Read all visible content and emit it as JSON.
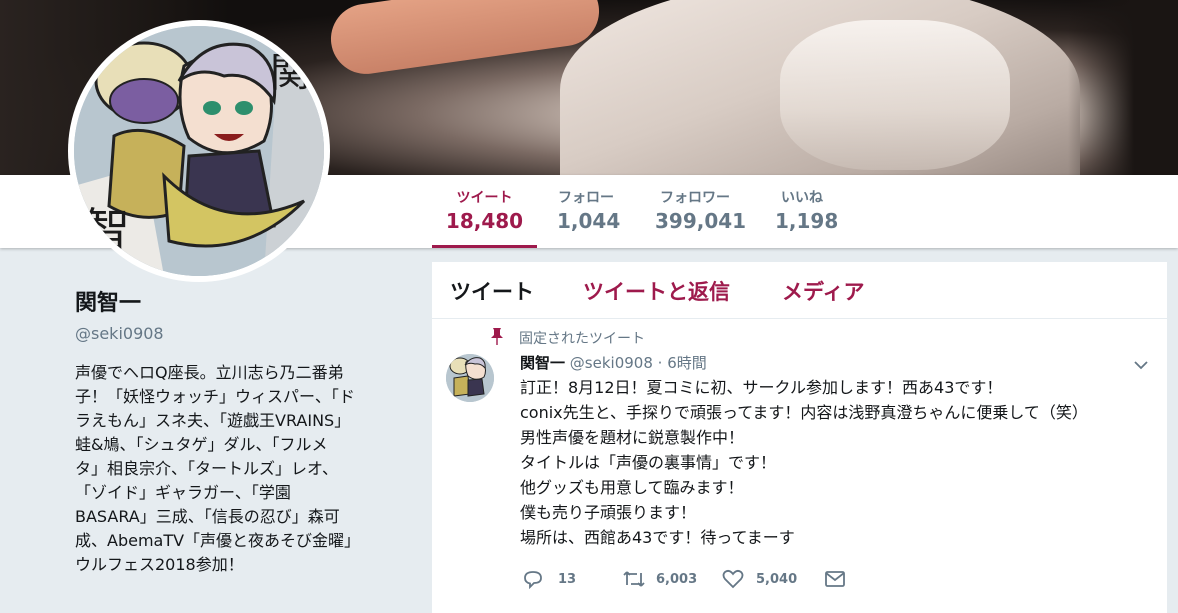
{
  "stats": [
    {
      "label": "ツイート",
      "value": "18,480"
    },
    {
      "label": "フォロー",
      "value": "1,044"
    },
    {
      "label": "フォロワー",
      "value": "399,041"
    },
    {
      "label": "いいね",
      "value": "1,198"
    }
  ],
  "profile": {
    "name": "関智一",
    "handle": "@seki0908",
    "bio_lines": [
      "声優でヘロQ座長。立川志ら乃二番弟",
      "子！「妖怪ウォッチ」ウィスパー、「ド",
      "ラえもん」スネ夫、「遊戯王VRAINS」",
      "蛙&鳩、「シュタゲ」ダル、「フルメ",
      "タ」相良宗介、「タートルズ」レオ、",
      "「ゾイド」ギャラガー、「学園",
      "BASARA」三成、「信長の忍び」森可",
      "成、AbemaTV「声優と夜あそび金曜」",
      "ウルフェス2018参加！"
    ]
  },
  "tabs": [
    "ツイート",
    "ツイートと返信",
    "メディア"
  ],
  "tweet": {
    "pinned_label": "固定されたツイート",
    "author_name": "関智一",
    "author_handle": "@seki0908",
    "separator": "·",
    "time": "6時間",
    "lines": [
      "訂正！8月12日！夏コミに初、サークル参加します！西あ43です！",
      " conix先生と、手探りで頑張ってます！内容は浅野真澄ちゃんに便乗して（笑）",
      "男性声優を題材に鋭意製作中！",
      "タイトルは「声優の裏事情」です！",
      "他グッズも用意して臨みます！",
      "僕も売り子頑張ります！",
      "場所は、西館あ43です！待ってまーす"
    ],
    "replies": "13",
    "retweets": "6,003",
    "likes": "5,040"
  },
  "icons": {
    "pin": "pin-icon",
    "chevron": "chevron-down-icon",
    "reply": "reply-icon",
    "retweet": "retweet-icon",
    "like": "heart-icon",
    "message": "envelope-icon"
  },
  "colors": {
    "accent": "#9e1a4c",
    "muted": "#657786",
    "background": "#e6ecf0"
  }
}
